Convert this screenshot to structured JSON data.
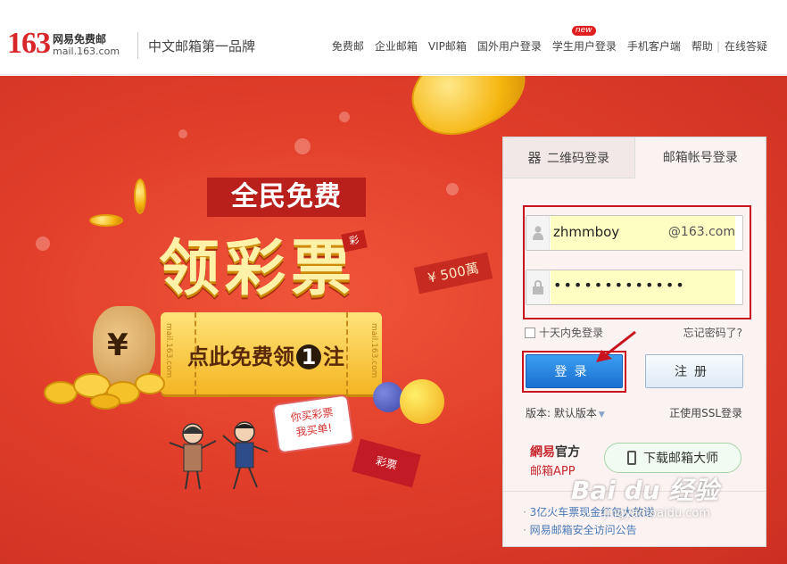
{
  "header": {
    "logo_number": "163",
    "logo_cn": "网易免费邮",
    "logo_en": "mail.163.com",
    "slogan": "中文邮箱第一品牌",
    "nav": [
      {
        "label": "免费邮"
      },
      {
        "label": "企业邮箱"
      },
      {
        "label": "VIP邮箱"
      },
      {
        "label": "国外用户登录"
      },
      {
        "label": "学生用户登录",
        "badge": "new"
      },
      {
        "label": "手机客户端"
      },
      {
        "label": "帮助"
      },
      {
        "label": "在线答疑"
      }
    ]
  },
  "banner": {
    "ribbon": "全民免费",
    "title": "领彩票",
    "cai_badge": "彩",
    "prize": "¥ 500萬",
    "ticket_text_a": "点此免费领",
    "ticket_number": "1",
    "ticket_text_b": "注",
    "ticket_side": "mail.163.com",
    "moneybag_symbol": "¥",
    "speech_line1": "你买彩票",
    "speech_line2": "我买单!",
    "caipiao_tag": "彩票"
  },
  "login": {
    "tab_qr": "二维码登录",
    "tab_account": "邮箱帐号登录",
    "username": "zhmmboy",
    "domain": "@163.com",
    "password_mask": "•••••••••••••",
    "remember_label": "十天内免登录",
    "forgot_label": "忘记密码了?",
    "login_label": "登录",
    "register_label": "注册",
    "version_label": "版本: 默认版本",
    "ssl_label": "正使用SSL登录",
    "app_brand": "網易",
    "app_brand_b": "官方",
    "app_name": "邮箱APP",
    "download_label": "下载邮箱大师",
    "notices": [
      "3亿火车票现金红包大放送",
      "网易邮箱安全访问公告"
    ]
  },
  "watermark": {
    "main": "Bai du 经验",
    "sub": "jingyan.baidu.com"
  },
  "colors": {
    "brand_red": "#d8262b",
    "banner_red": "#e23f2b",
    "login_blue": "#1a6fd0",
    "highlight_red": "#c9141f"
  }
}
